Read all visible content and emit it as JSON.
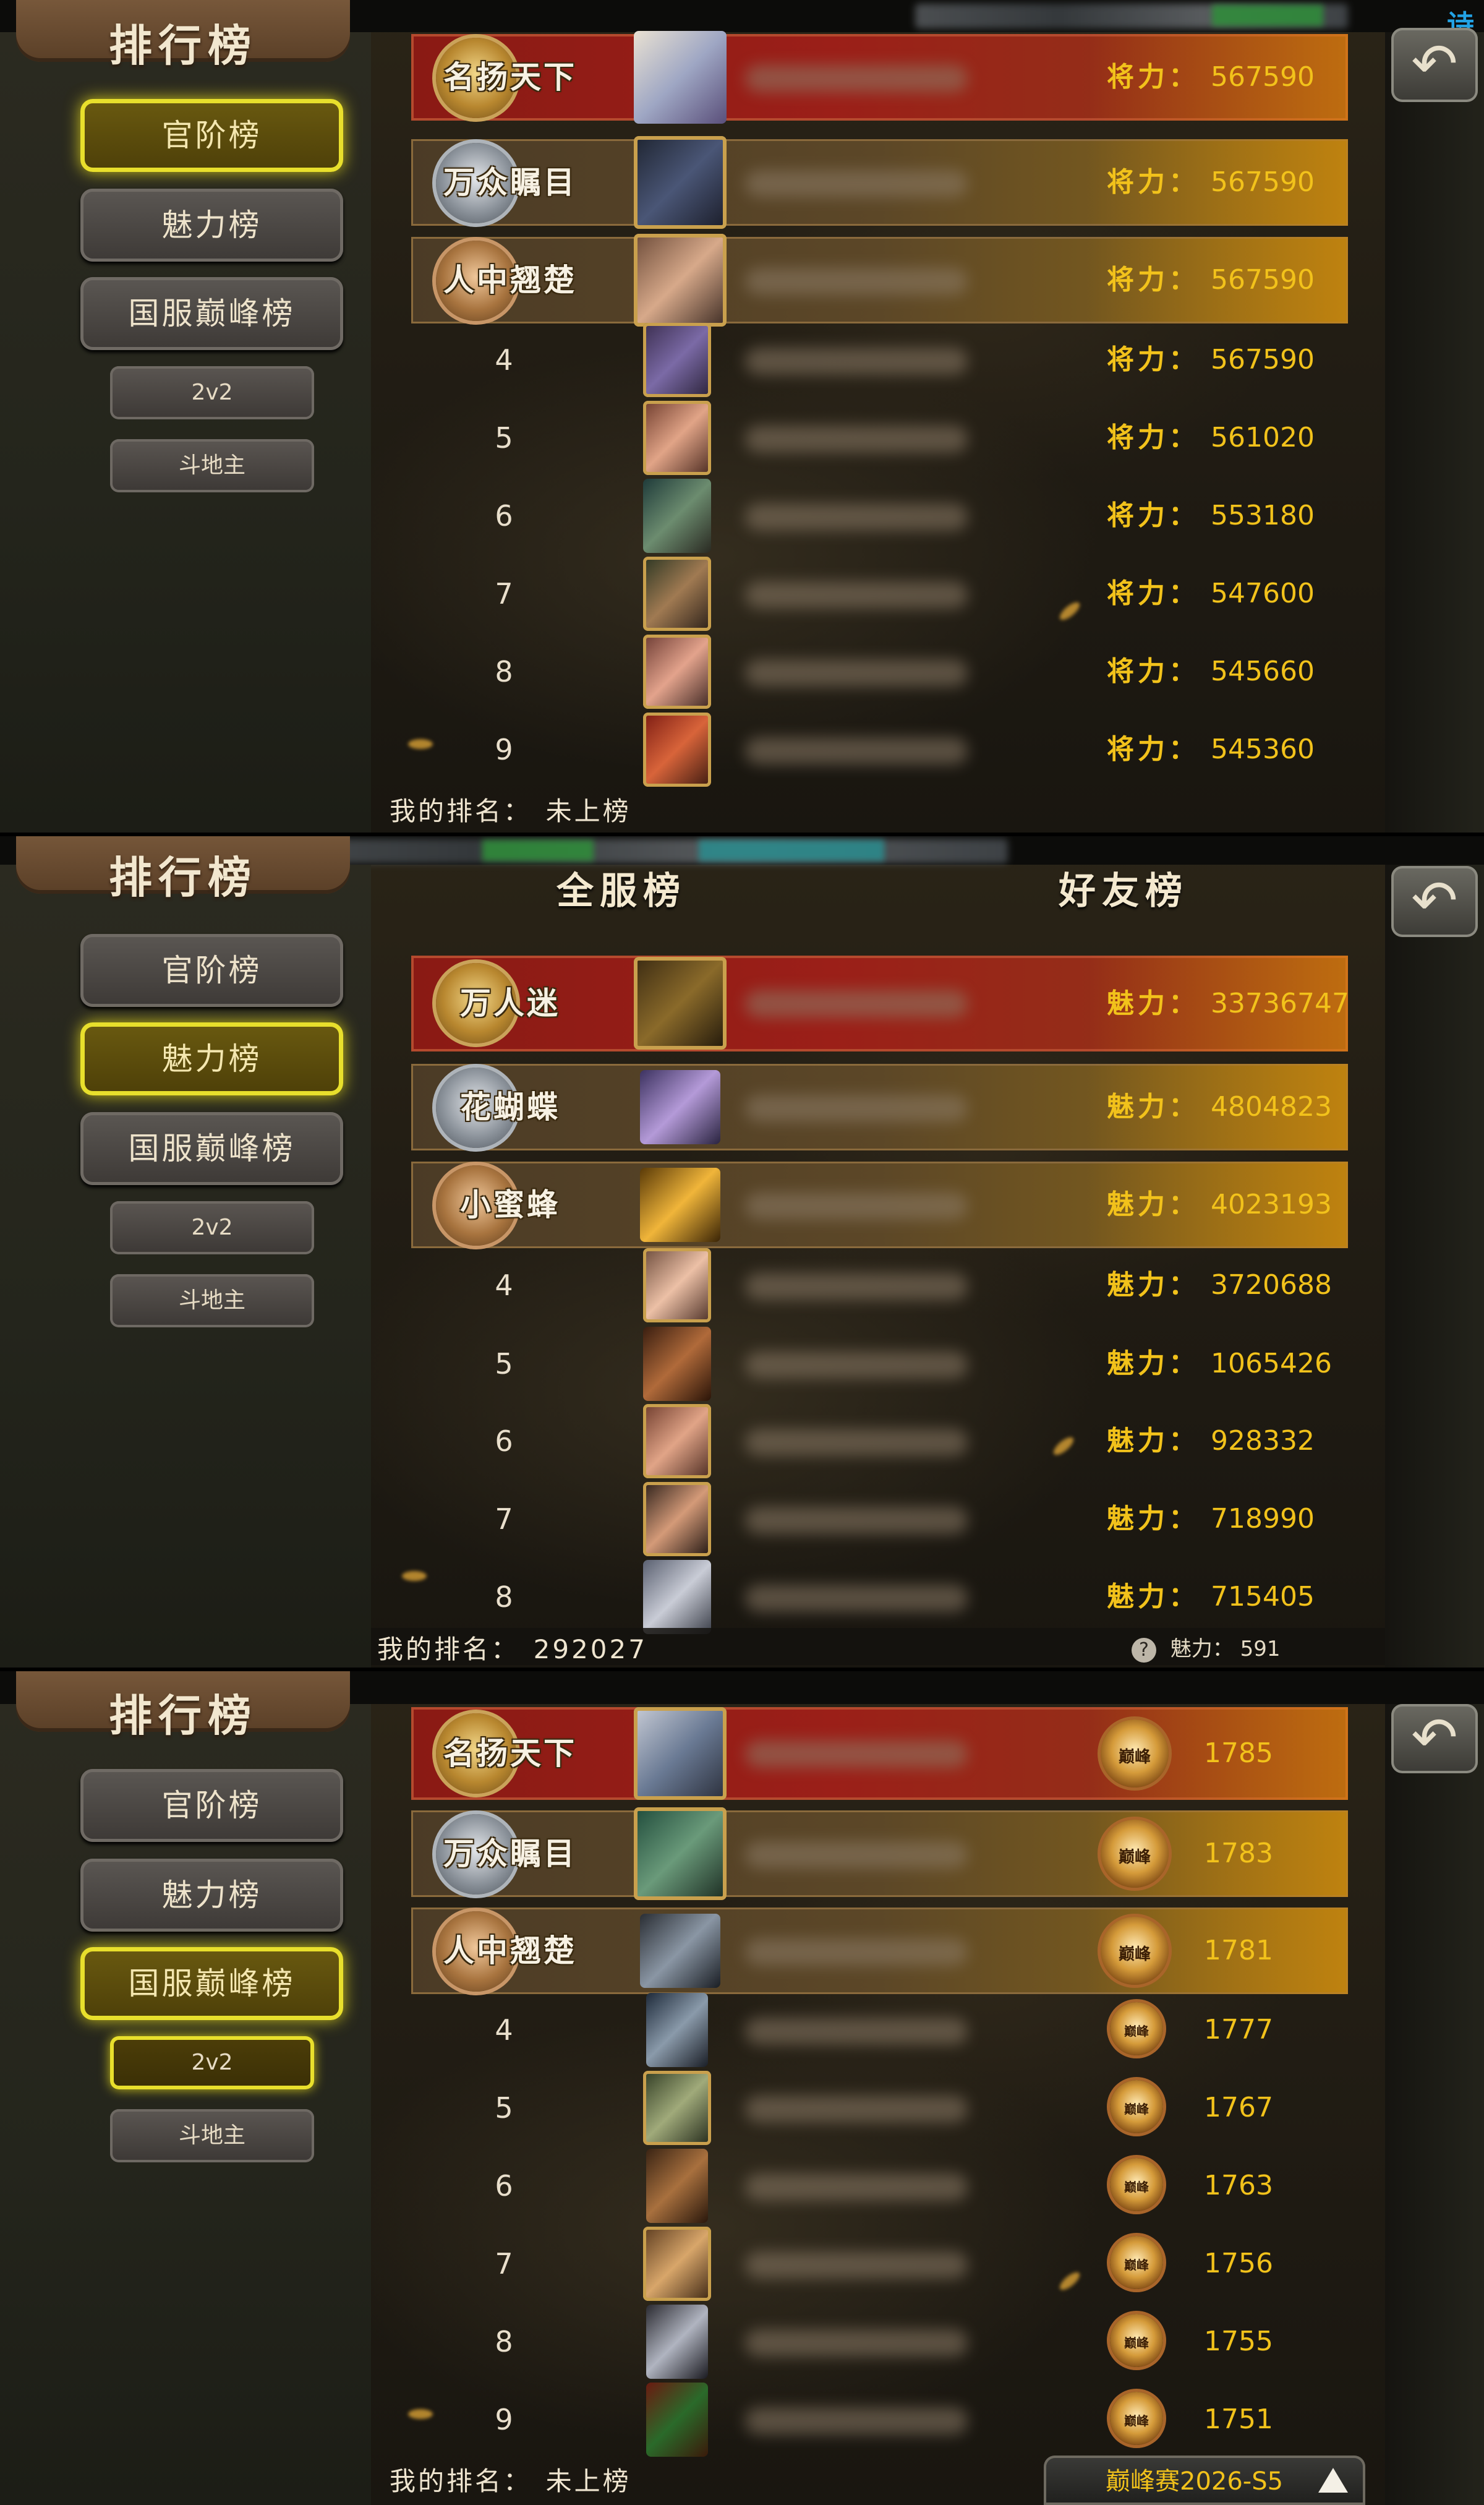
{
  "common": {
    "ranking_title": "排行榜",
    "nav": {
      "official": "官阶榜",
      "charm": "魅力榜",
      "peak": "国服巅峰榜",
      "mode_2v2": "2v2",
      "landlord": "斗地主"
    },
    "back_icon": "back-arrow-icon",
    "corner_text": "诗"
  },
  "panel1": {
    "active_nav": "官阶榜",
    "value_label": "将力：",
    "rows": [
      {
        "rank": "1",
        "title": "名扬天下",
        "medal": "gold",
        "value": "567590"
      },
      {
        "rank": "2",
        "title": "万众瞩目",
        "medal": "silver",
        "value": "567590"
      },
      {
        "rank": "3",
        "title": "人中翘楚",
        "medal": "bronze",
        "value": "567590"
      },
      {
        "rank": "4",
        "value": "567590"
      },
      {
        "rank": "5",
        "value": "561020"
      },
      {
        "rank": "6",
        "value": "553180"
      },
      {
        "rank": "7",
        "value": "547600"
      },
      {
        "rank": "8",
        "value": "545660"
      },
      {
        "rank": "9",
        "value": "545360"
      }
    ],
    "my_rank_label": "我的排名：",
    "my_rank_value": "未上榜"
  },
  "panel2": {
    "active_nav": "魅力榜",
    "tabs": {
      "server": "全服榜",
      "friends": "好友榜"
    },
    "value_label": "魅力：",
    "rows": [
      {
        "rank": "1",
        "title": "万人迷",
        "medal": "gold",
        "value": "33736747"
      },
      {
        "rank": "2",
        "title": "花蝴蝶",
        "medal": "silver",
        "value": "4804823"
      },
      {
        "rank": "3",
        "title": "小蜜蜂",
        "medal": "bronze",
        "value": "4023193"
      },
      {
        "rank": "4",
        "value": "3720688"
      },
      {
        "rank": "5",
        "value": "1065426"
      },
      {
        "rank": "6",
        "value": "928332"
      },
      {
        "rank": "7",
        "value": "718990"
      },
      {
        "rank": "8",
        "value": "715405"
      }
    ],
    "my_rank_label": "我的排名：",
    "my_rank_value": "292027",
    "my_charm_label": "魅力：",
    "my_charm_value": "591"
  },
  "panel3": {
    "active_nav": "国服巅峰榜",
    "active_sub": "2v2",
    "badge_text": "巅峰",
    "rows": [
      {
        "rank": "1",
        "title": "名扬天下",
        "medal": "gold",
        "score": "1785"
      },
      {
        "rank": "2",
        "title": "万众瞩目",
        "medal": "silver",
        "score": "1783"
      },
      {
        "rank": "3",
        "title": "人中翘楚",
        "medal": "bronze",
        "score": "1781"
      },
      {
        "rank": "4",
        "score": "1777"
      },
      {
        "rank": "5",
        "score": "1767"
      },
      {
        "rank": "6",
        "score": "1763"
      },
      {
        "rank": "7",
        "score": "1756"
      },
      {
        "rank": "8",
        "score": "1755"
      },
      {
        "rank": "9",
        "score": "1751"
      }
    ],
    "my_rank_label": "我的排名：",
    "my_rank_value": "未上榜",
    "season_label": "巅峰赛2026-S5"
  },
  "colors": {
    "accent_gold": "#f2c21b",
    "active_outline": "#e8df2c",
    "first_row_red": "#9b1f18"
  }
}
